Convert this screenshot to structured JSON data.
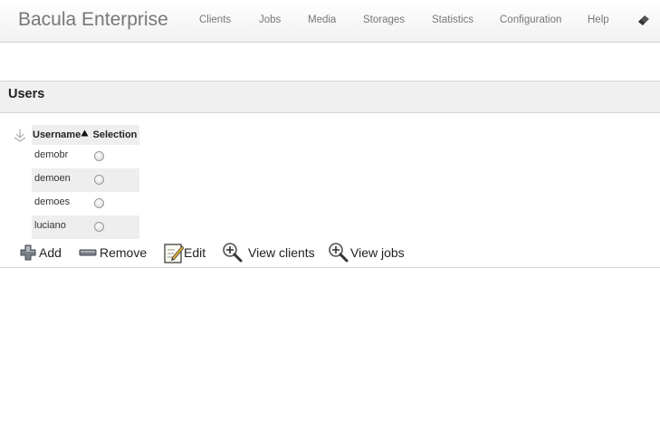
{
  "header": {
    "brand": "Bacula Enterprise",
    "nav": [
      {
        "label": "Clients"
      },
      {
        "label": "Jobs"
      },
      {
        "label": "Media"
      },
      {
        "label": "Storages"
      },
      {
        "label": "Statistics"
      },
      {
        "label": "Configuration"
      },
      {
        "label": "Help"
      }
    ],
    "tool_icon": "eraser-icon"
  },
  "section": {
    "title": "Users"
  },
  "grid": {
    "columns": [
      "Username",
      "Selection"
    ],
    "sort_column": "Username",
    "sort_direction": "ascending",
    "rows": [
      {
        "username": "demobr",
        "selected": false
      },
      {
        "username": "demoen",
        "selected": false
      },
      {
        "username": "demoes",
        "selected": false
      },
      {
        "username": "luciano",
        "selected": false
      }
    ]
  },
  "actions": {
    "add": "Add",
    "remove": "Remove",
    "edit": "Edit",
    "view_clients": "View clients",
    "view_jobs": "View jobs"
  },
  "colors": {
    "header_bg": "#f1f1f1",
    "nav_text": "#777777",
    "section_bg": "#f0f0f0",
    "row_alt": "#eeeeee"
  }
}
